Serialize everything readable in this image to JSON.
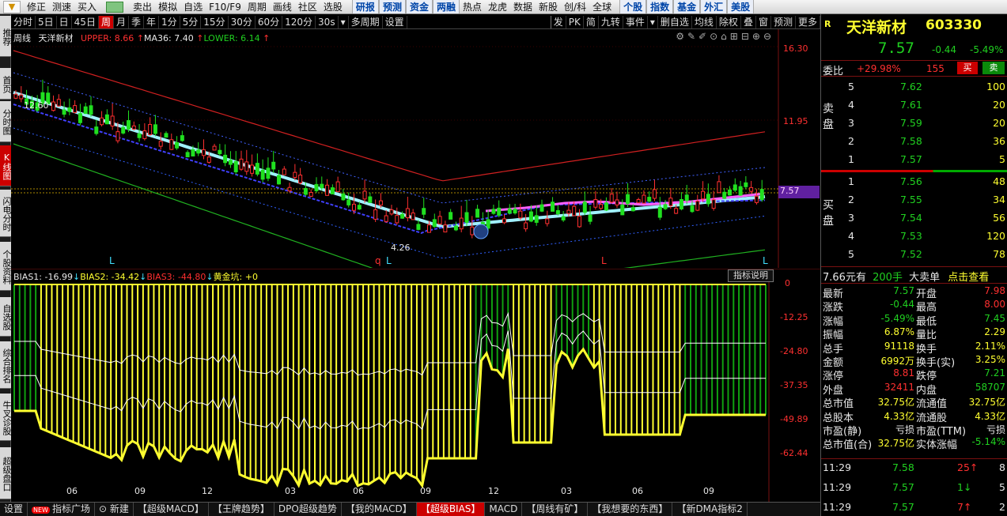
{
  "toolbar": {
    "arrow_icon": "down-arrow-icon",
    "items": [
      "修正",
      "测速",
      "买入",
      "卖出",
      "模拟",
      "自选",
      "F10/F9",
      "周期",
      "画线",
      "社区",
      "选股"
    ],
    "highlight_items": [
      "研报",
      "预测",
      "资金",
      "两融"
    ],
    "more_items": [
      "热点",
      "龙虎",
      "数据",
      "新股",
      "创/科",
      "全球"
    ],
    "right_items": [
      "个股",
      "指数",
      "基金",
      "外汇",
      "美股"
    ]
  },
  "left_tabs": [
    "推荐",
    "首页",
    "分时图",
    "K线图",
    "闪电分时",
    "个股资料",
    "自选股",
    "综合排名",
    "牛叉诊股",
    "超级盘口"
  ],
  "left_active": "K线图",
  "period_bar": {
    "items": [
      "分时",
      "5日",
      "日",
      "45日",
      "周",
      "月",
      "季",
      "年",
      "1分",
      "5分",
      "15分",
      "30分",
      "60分",
      "120分",
      "30s",
      "多周期",
      "设置"
    ],
    "active": "周",
    "right_items": [
      "发",
      "PK",
      "简",
      "九转",
      "事件",
      "删自选",
      "均线",
      "除权",
      "叠",
      "窗",
      "预测",
      "更多"
    ]
  },
  "main_chart": {
    "legend": {
      "period": "周线",
      "stock": "天洋新材",
      "upper": "UPPER: 8.66",
      "ma": "MA36: 7.40",
      "lower": "LOWER: 6.14"
    },
    "y_ticks": [
      "16.30",
      "11.95",
      "7.57"
    ],
    "hi_label": "12.60",
    "lo_label": "4.26",
    "markers": [
      "L",
      "q",
      "L",
      "L",
      "L"
    ]
  },
  "sub_chart": {
    "legend": {
      "bias1": "BIAS1: -16.99",
      "bias2": "BIAS2: -34.42",
      "bias3": "BIAS3: -44.80",
      "pit": "黄金坑: +0"
    },
    "help_button": "指标说明",
    "y_ticks": [
      "0",
      "-12.25",
      "-24.80",
      "-37.35",
      "-49.89",
      "-62.44"
    ],
    "x_ticks": [
      "06",
      "09",
      "12",
      "03",
      "06",
      "09",
      "12",
      "03",
      "06",
      "09"
    ]
  },
  "bottom_tabs": {
    "settings": "设置",
    "new_badge": "NEW",
    "items": [
      "指标广场",
      "新建",
      "【超级MACD】",
      "【王牌趋势】",
      "DPO超级趋势",
      "【我的MACD】",
      "【超级BIAS】",
      "MACD",
      "【周线有矿】",
      "【我想要的东西】",
      "【新DMA指标2"
    ],
    "active": "【超级BIAS】"
  },
  "quote": {
    "logo": "R",
    "name": "天洋新材",
    "code": "603330",
    "price": "7.57",
    "change": "-0.44",
    "pct": "-5.49%",
    "weibi_label": "委比",
    "weibi": "+29.98%",
    "weicha": "155",
    "buy_btn": "买",
    "sell_btn": "卖",
    "sell_label": "卖盘",
    "buy_label": "买盘",
    "asks": [
      {
        "lvl": "5",
        "price": "7.62",
        "vol": "100"
      },
      {
        "lvl": "4",
        "price": "7.61",
        "vol": "20"
      },
      {
        "lvl": "3",
        "price": "7.59",
        "vol": "20"
      },
      {
        "lvl": "2",
        "price": "7.58",
        "vol": "36"
      },
      {
        "lvl": "1",
        "price": "7.57",
        "vol": "5"
      }
    ],
    "bids": [
      {
        "lvl": "1",
        "price": "7.56",
        "vol": "48"
      },
      {
        "lvl": "2",
        "price": "7.55",
        "vol": "34"
      },
      {
        "lvl": "3",
        "price": "7.54",
        "vol": "56"
      },
      {
        "lvl": "4",
        "price": "7.53",
        "vol": "120"
      },
      {
        "lvl": "5",
        "price": "7.52",
        "vol": "78"
      }
    ],
    "bigorder": {
      "price": "7.66元有",
      "vol": "200手",
      "label": "大卖单",
      "link": "点击查看"
    },
    "stats": [
      [
        "最新",
        "7.57",
        "开盘",
        "7.98"
      ],
      [
        "涨跌",
        "-0.44",
        "最高",
        "8.00"
      ],
      [
        "涨幅",
        "-5.49%",
        "最低",
        "7.45"
      ],
      [
        "振幅",
        "6.87%",
        "量比",
        "2.29"
      ],
      [
        "总手",
        "91118",
        "换手",
        "2.11%"
      ],
      [
        "金额",
        "6992万",
        "换手(实)",
        "3.25%"
      ],
      [
        "涨停",
        "8.81",
        "跌停",
        "7.21"
      ],
      [
        "外盘",
        "32411",
        "内盘",
        "58707"
      ],
      [
        "总市值",
        "32.75亿",
        "流通值",
        "32.75亿"
      ],
      [
        "总股本",
        "4.33亿",
        "流通股",
        "4.33亿"
      ],
      [
        "市盈(静)",
        "亏损",
        "市盈(TTM)",
        "亏损"
      ],
      [
        "总市值(合)",
        "32.75亿",
        "实体涨幅",
        "-5.14%"
      ]
    ],
    "ticks": [
      {
        "time": "11:29",
        "price": "7.58",
        "vol": "25",
        "dir": "up",
        "n": "8"
      },
      {
        "time": "11:29",
        "price": "7.57",
        "vol": "1",
        "dir": "down",
        "n": "5"
      },
      {
        "time": "11:29",
        "price": "7.57",
        "vol": "7",
        "dir": "up",
        "n": "2"
      }
    ]
  },
  "colors": {
    "up": "#ff3030",
    "down": "#20d020",
    "bias_yellow": "#ffff30",
    "ma": "#a0f0ff",
    "active_tab": "#cc0000"
  }
}
